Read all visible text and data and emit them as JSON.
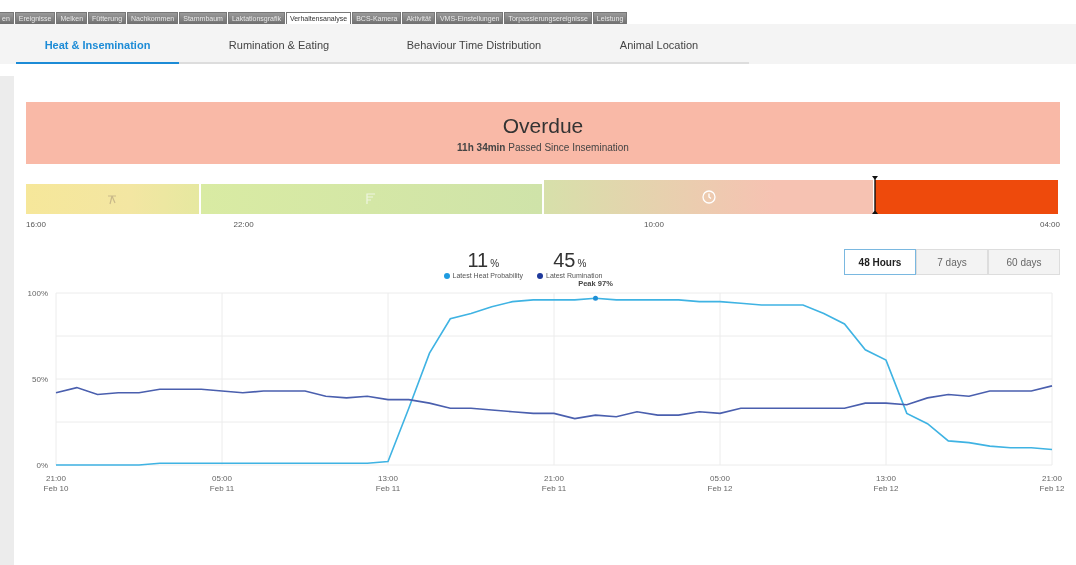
{
  "module_tabs": [
    {
      "label": "en",
      "selected": false
    },
    {
      "label": "Ereignisse",
      "selected": false
    },
    {
      "label": "Melken",
      "selected": false
    },
    {
      "label": "Fütterung",
      "selected": false
    },
    {
      "label": "Nachkommen",
      "selected": false
    },
    {
      "label": "Stammbaum",
      "selected": false
    },
    {
      "label": "Laktationsgrafik",
      "selected": false
    },
    {
      "label": "Verhaltensanalyse",
      "selected": true
    },
    {
      "label": "BCS-Kamera",
      "selected": false
    },
    {
      "label": "Aktivität",
      "selected": false
    },
    {
      "label": "VMS-Einstellungen",
      "selected": false
    },
    {
      "label": "Torpassierungsereignisse",
      "selected": false
    },
    {
      "label": "Leistung",
      "selected": false
    }
  ],
  "tabs": [
    {
      "label": "Heat & Insemination",
      "selected": true
    },
    {
      "label": "Rumination & Eating",
      "selected": false
    },
    {
      "label": "Behaviour Time Distribution",
      "selected": false
    },
    {
      "label": "Animal Location",
      "selected": false
    }
  ],
  "status_banner": {
    "title": "Overdue",
    "subtitle": "**11h 34min** Passed Since Insemination"
  },
  "timeline": {
    "segments": [
      {
        "kind": "early",
        "color": "#f6e79a"
      },
      {
        "kind": "optimal",
        "color": "#cfe3a9"
      },
      {
        "kind": "late",
        "color": "#f6c2b2"
      },
      {
        "kind": "overdue",
        "color": "#ee4a0c"
      }
    ],
    "labels": [
      "16:00",
      "22:00",
      "10:00",
      "04:00"
    ]
  },
  "stats": [
    {
      "value": "11",
      "unit": "%",
      "label": "Latest Heat Probability",
      "color": "#1e9be0"
    },
    {
      "value": "45",
      "unit": "%",
      "label": "Latest Rumination",
      "color": "#1f3a9c"
    }
  ],
  "range_buttons": [
    {
      "label": "48 Hours",
      "selected": true
    },
    {
      "label": "7 days",
      "selected": false
    },
    {
      "label": "60 days",
      "selected": false
    }
  ],
  "chart_data": {
    "type": "line",
    "categories": [
      "21:00\nFeb 10",
      null,
      null,
      null,
      null,
      null,
      null,
      null,
      "05:00\nFeb 11",
      null,
      null,
      null,
      null,
      null,
      null,
      null,
      "13:00\nFeb 11",
      null,
      null,
      null,
      null,
      null,
      null,
      null,
      "21:00\nFeb 11",
      null,
      null,
      null,
      null,
      null,
      null,
      null,
      "05:00\nFeb 12",
      null,
      null,
      null,
      null,
      null,
      null,
      null,
      "13:00\nFeb 12",
      null,
      null,
      null,
      null,
      null,
      null,
      null,
      "21:00\nFeb 12"
    ],
    "series": [
      {
        "color": "#3fb3e3",
        "values": [
          0,
          0,
          0,
          0,
          0,
          1,
          1,
          1,
          1,
          1,
          1,
          1,
          1,
          1,
          1,
          1,
          2,
          33,
          65,
          85,
          88,
          92,
          95,
          96,
          96,
          96,
          97,
          96,
          96,
          96,
          96,
          95,
          95,
          94,
          93,
          93,
          93,
          88,
          82,
          67,
          61,
          30,
          24,
          14,
          13,
          11,
          10,
          10,
          9
        ]
      },
      {
        "color": "#4a5fae",
        "values": [
          42,
          45,
          41,
          42,
          42,
          44,
          44,
          44,
          43,
          42,
          43,
          43,
          43,
          40,
          39,
          40,
          38,
          38,
          36,
          33,
          33,
          32,
          31,
          30,
          30,
          27,
          29,
          28,
          31,
          29,
          29,
          31,
          30,
          33,
          33,
          33,
          33,
          33,
          33,
          36,
          36,
          35,
          39,
          41,
          40,
          43,
          43,
          43,
          46
        ]
      }
    ],
    "ylim": [
      0,
      100
    ],
    "yticks": [
      {
        "value": 0,
        "label": "0%"
      },
      {
        "value": 50,
        "label": "50%"
      },
      {
        "value": 100,
        "label": "100%"
      }
    ],
    "grid": true,
    "annotations": [
      {
        "y": 97,
        "text": "Peak 97%"
      }
    ]
  }
}
